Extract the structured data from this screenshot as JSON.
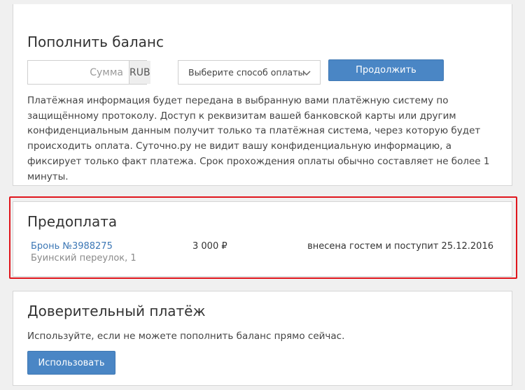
{
  "topup": {
    "title": "Пополнить баланс",
    "amount_placeholder": "Сумма",
    "currency": "RUB",
    "payment_method": "Выберите способ оплаты",
    "continue_label": "Продолжить",
    "notice": "Платёжная информация будет передана в выбранную вами платёжную систему по защищённому протоколу. Доступ к реквизитам вашей банковской карты или другим конфиденциальным данным получит только та платёжная система, через которую будет происходить оплата. Суточно.ру не видит вашу конфиденциальную информацию, а фиксирует только факт платежа. Срок прохождения оплаты обычно составляет не более 1 минуты."
  },
  "prepayment": {
    "title": "Предоплата",
    "booking_link": "Бронь №3988275",
    "address": "Буинский переулок, 1",
    "amount": "3 000 ₽",
    "status": "внесена гостем и поступит 25.12.2016"
  },
  "trust_payment": {
    "title": "Доверительный платёж",
    "description": "Используйте, если не можете пополнить баланс прямо сейчас.",
    "use_label": "Использовать"
  },
  "colors": {
    "accent": "#4a86c5",
    "link": "#3c77b5",
    "highlight": "#e0151c"
  },
  "icons": {
    "select_arrow": "chevron-down-icon"
  }
}
